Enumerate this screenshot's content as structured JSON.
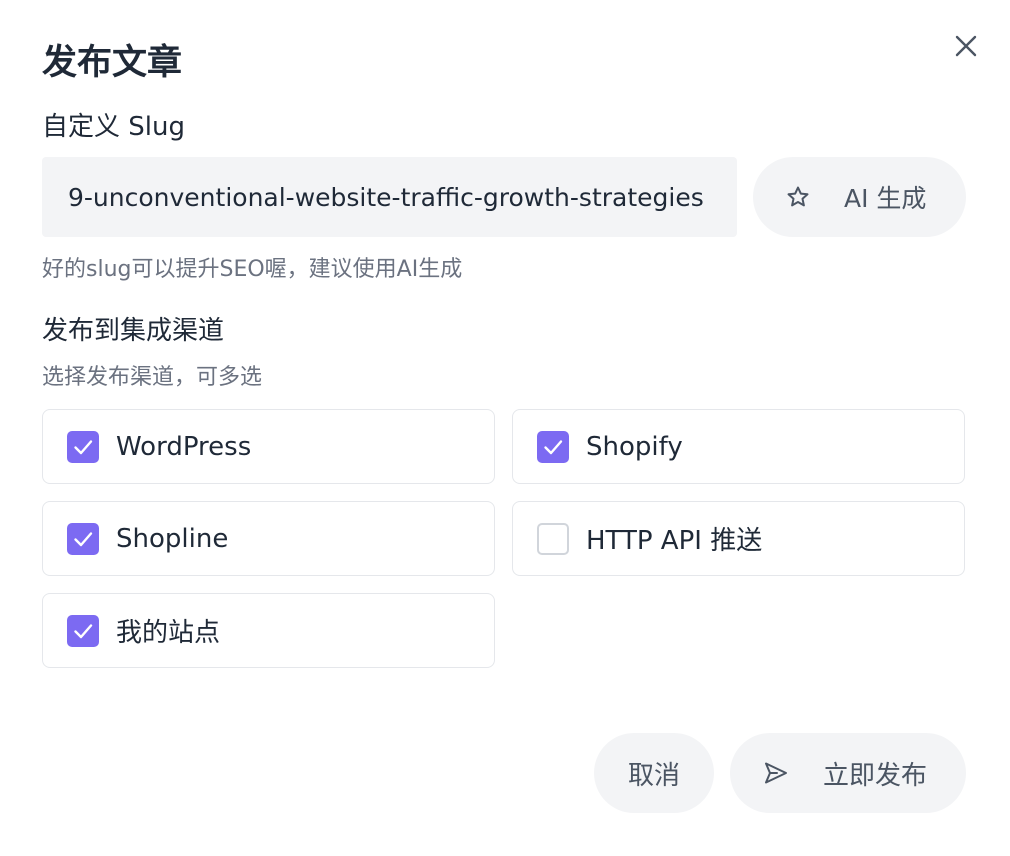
{
  "dialog": {
    "title": "发布文章",
    "close_icon": "close-icon"
  },
  "slug": {
    "label": "自定义 Slug",
    "value": "9-unconventional-website-traffic-growth-strategies",
    "hint": "好的slug可以提升SEO喔，建议使用AI生成",
    "ai_button_label": "AI 生成",
    "ai_button_icon": "star-icon"
  },
  "channels": {
    "title": "发布到集成渠道",
    "subtitle": "选择发布渠道，可多选",
    "items": [
      {
        "label": "WordPress",
        "checked": true
      },
      {
        "label": "Shopify",
        "checked": true
      },
      {
        "label": "Shopline",
        "checked": true
      },
      {
        "label": "HTTP API 推送",
        "checked": false
      },
      {
        "label": "我的站点",
        "checked": true
      }
    ]
  },
  "footer": {
    "cancel_label": "取消",
    "publish_label": "立即发布",
    "publish_icon": "send-icon"
  },
  "colors": {
    "accent": "#7c6af2",
    "button_bg": "#f3f4f6",
    "text_primary": "#1f2937",
    "text_secondary": "#6b7280",
    "border": "#e5e7eb"
  }
}
